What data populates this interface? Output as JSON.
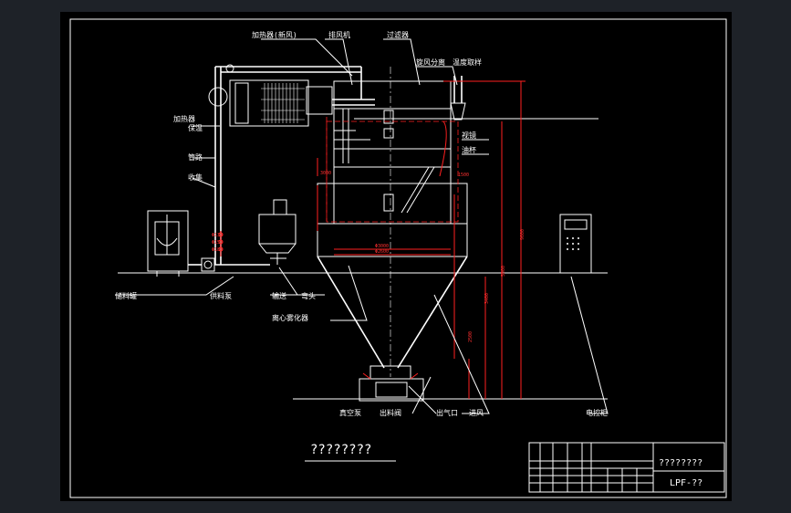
{
  "title": "????????",
  "drawing_no": "LPF-??",
  "titleblock_name": "????????",
  "callouts": {
    "heater_fresh_air": "加热器(新风)",
    "exhaust_fan": "排风机",
    "filter": "过滤器",
    "cyclone": "旋风分离",
    "sample_port": "温度取样",
    "insulation": "保温",
    "pipe": "管路",
    "collector": "收集",
    "solution_tank": "储料罐",
    "feed_pump": "供料泵",
    "delivery_pump": "输送",
    "centrifugal_atomizer": "离心雾化器",
    "sight_glass": "视镜",
    "oil_cup": "油杯",
    "elbow": "弯头",
    "vacuum_pump": "真空泵",
    "discharge_valve": "出料阀",
    "gas_discharge": "出气口",
    "control_cabinet": "电控柜",
    "air_inlet": "进风",
    "heater": "加热器"
  },
  "dimensions": {
    "d_top": "Φ2600",
    "d_body": "Φ3000",
    "h_total": "9600",
    "h_cone": "5000",
    "h_skirt": "3400",
    "h_outlet": "2500",
    "h_upper": "3000",
    "h_side": "1500",
    "h_mid": "2600",
    "t1": "Φ130",
    "t2": "Φ150",
    "t3": "Φ180"
  },
  "colors": {
    "line": "#ffffff",
    "dimension": "#ff2020",
    "background": "#000000",
    "frame": "#1e2228"
  }
}
